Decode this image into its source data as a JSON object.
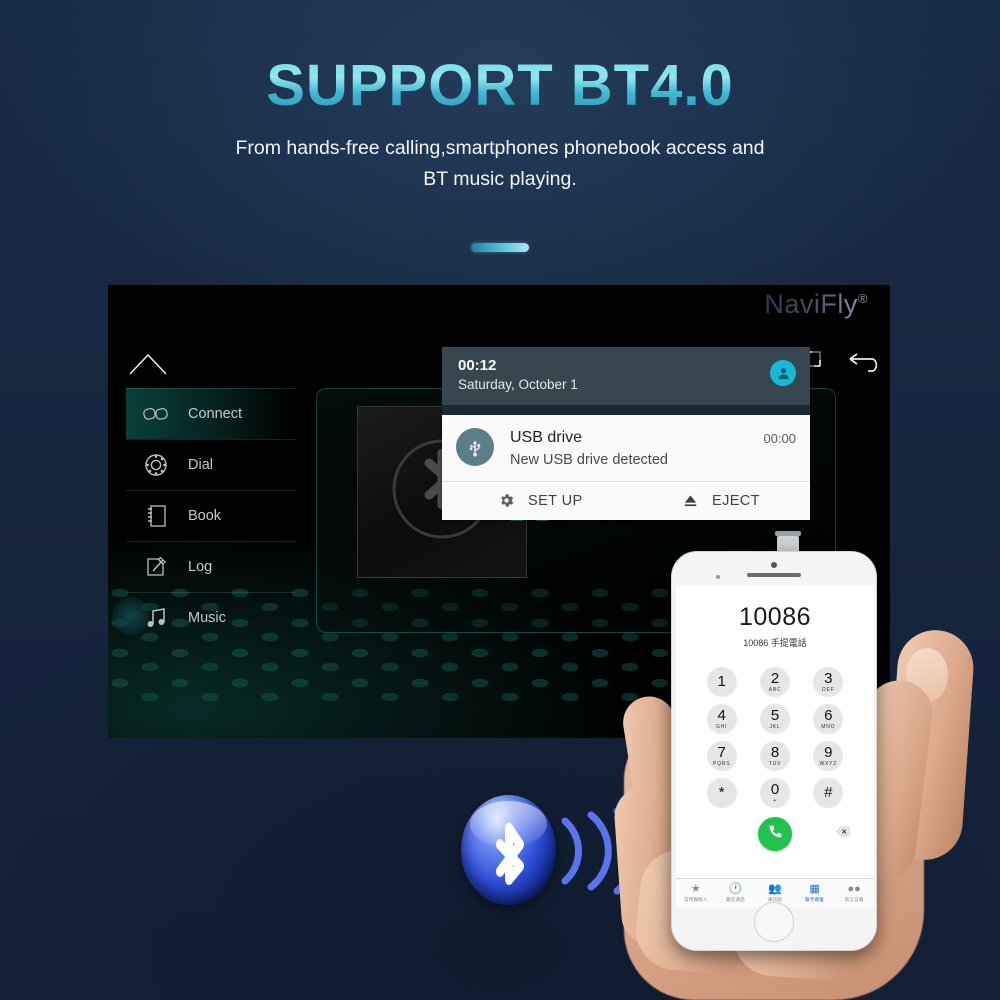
{
  "page": {
    "headline": "SUPPORT BT4.0",
    "subline_line1": "From hands-free calling,smartphones phonebook access and",
    "subline_line2": "BT music playing.",
    "background_color": "#16263d",
    "accent_color": "#6fd8e8"
  },
  "headunit": {
    "brand_logo": "NaviFly",
    "brand_mark": "®",
    "nav": {
      "home_label": "home-nav",
      "recents_label": "recents-nav",
      "back_label": "back-nav"
    },
    "sidebar": [
      {
        "label": "Connect",
        "icon": "link-icon",
        "active": true
      },
      {
        "label": "Dial",
        "icon": "rotary-dial-icon",
        "active": false
      },
      {
        "label": "Book",
        "icon": "contact-book-icon",
        "active": false
      },
      {
        "label": "Log",
        "icon": "edit-log-icon",
        "active": false
      },
      {
        "label": "Music",
        "icon": "music-note-icon",
        "active": false
      }
    ],
    "panel": {
      "artwork_icon": "bluetooth-logo",
      "link_icon": "link-icon"
    }
  },
  "notification_shade": {
    "time": "00:12",
    "date": "Saturday, October 1",
    "avatar_icon": "user-avatar-icon",
    "avatar_color": "#18b9d6",
    "status_bg": "#37474f",
    "notification": {
      "icon": "usb-icon",
      "title": "USB drive",
      "subtitle": "New USB drive detected",
      "timestamp": "00:00",
      "actions": [
        {
          "label": "SET UP",
          "icon": "gear-icon"
        },
        {
          "label": "EJECT",
          "icon": "eject-icon"
        }
      ]
    }
  },
  "bluetooth_emblem": {
    "icon": "bluetooth-icon",
    "waves": 3,
    "color": "#2f4fd8"
  },
  "phone": {
    "dialed_number": "10086",
    "carrier_line": "10086 手提電話",
    "keys": [
      {
        "digit": "1",
        "letters": ""
      },
      {
        "digit": "2",
        "letters": "ABC"
      },
      {
        "digit": "3",
        "letters": "DEF"
      },
      {
        "digit": "4",
        "letters": "GHI"
      },
      {
        "digit": "5",
        "letters": "JKL"
      },
      {
        "digit": "6",
        "letters": "MNO"
      },
      {
        "digit": "7",
        "letters": "PQRS"
      },
      {
        "digit": "8",
        "letters": "TUV"
      },
      {
        "digit": "9",
        "letters": "WXYZ"
      },
      {
        "digit": "*",
        "letters": ""
      },
      {
        "digit": "0",
        "letters": "+"
      },
      {
        "digit": "#",
        "letters": ""
      }
    ],
    "call_button_icon": "phone-call-icon",
    "call_button_color": "#23c24c",
    "delete_button_icon": "backspace-icon",
    "tabs": [
      {
        "label": "常用聯絡人",
        "icon": "star-icon",
        "active": false
      },
      {
        "label": "最近通話",
        "icon": "clock-icon",
        "active": false
      },
      {
        "label": "通訊錄",
        "icon": "contacts-icon",
        "active": false
      },
      {
        "label": "數字鍵盤",
        "icon": "keypad-icon",
        "active": true
      },
      {
        "label": "留言信箱",
        "icon": "voicemail-icon",
        "active": false
      }
    ]
  }
}
